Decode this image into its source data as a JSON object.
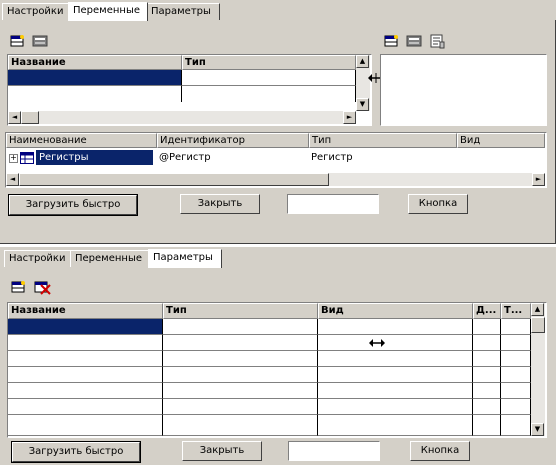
{
  "top": {
    "tabs": [
      {
        "label": "Настройки"
      },
      {
        "label": "Переменные"
      },
      {
        "label": "Параметры"
      }
    ],
    "vars_table": {
      "col_name": "Название",
      "col_type": "Тип"
    },
    "main_table": {
      "headers": [
        "Наименование",
        "Идентификатор",
        "Тип",
        "Вид"
      ],
      "row": {
        "name": "Регистры",
        "identifier": "@Регистр",
        "type": "Регистр",
        "kind": ""
      }
    },
    "buttons": {
      "load_fast": "Загрузить быстро",
      "close": "Закрыть",
      "button": "Кнопка"
    },
    "text_field_value": ""
  },
  "bottom": {
    "tabs": [
      {
        "label": "Настройки"
      },
      {
        "label": "Переменные"
      },
      {
        "label": "Параметры"
      }
    ],
    "params_table": {
      "headers": [
        "Название",
        "Тип",
        "Вид",
        "Д...",
        "Т..."
      ]
    },
    "buttons": {
      "load_fast": "Загрузить быстро",
      "close": "Закрыть",
      "button": "Кнопка"
    },
    "text_field_value": ""
  },
  "colors": {
    "panel": "#d4d0c8",
    "selection": "#0a246a"
  }
}
